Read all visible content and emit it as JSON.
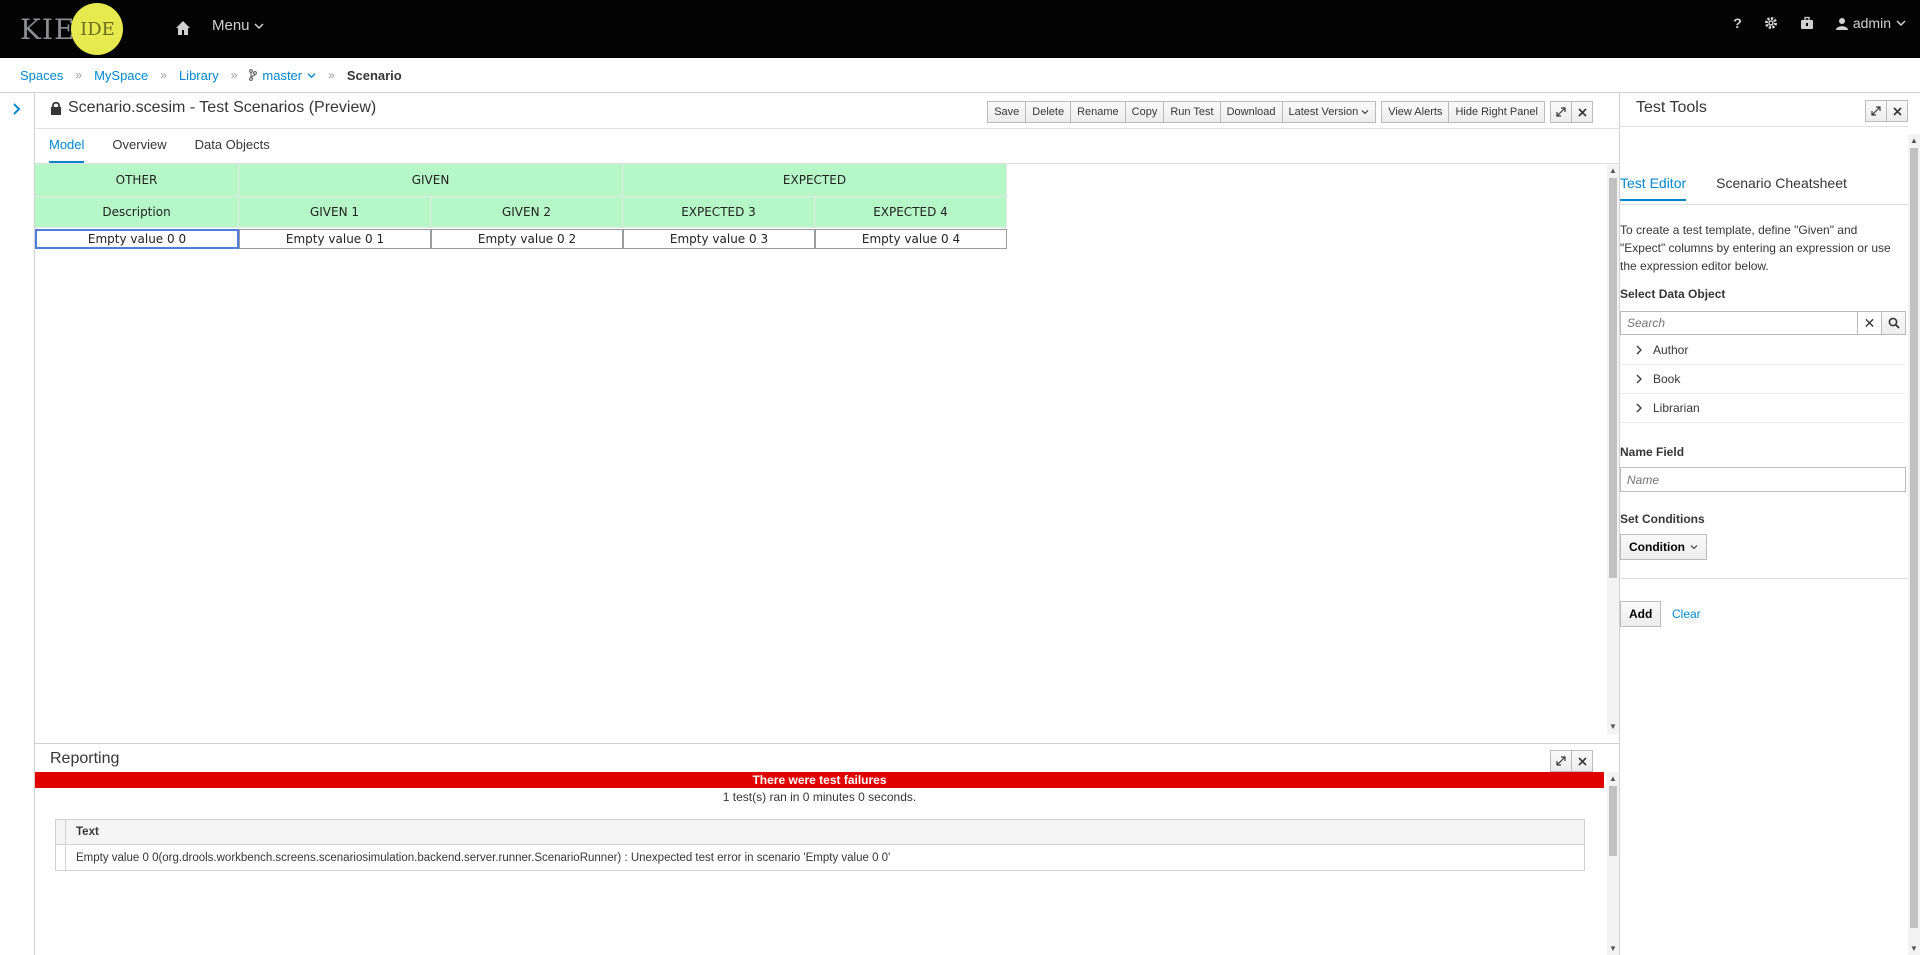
{
  "navbar": {
    "brand_kie": "KIE",
    "brand_ide": "IDE",
    "menu_label": "Menu",
    "help": "?",
    "user": "admin"
  },
  "breadcrumb": {
    "spaces": "Spaces",
    "myspace": "MySpace",
    "library": "Library",
    "branch": "master",
    "current": "Scenario"
  },
  "editor": {
    "title": "Scenario.scesim - Test Scenarios (Preview)",
    "toolbar": {
      "save": "Save",
      "delete": "Delete",
      "rename": "Rename",
      "copy": "Copy",
      "run_test": "Run Test",
      "download": "Download",
      "latest_version": "Latest Version",
      "view_alerts": "View Alerts",
      "hide_right_panel": "Hide Right Panel"
    },
    "tabs": [
      "Model",
      "Overview",
      "Data Objects"
    ]
  },
  "grid": {
    "groups": [
      "OTHER",
      "GIVEN",
      "EXPECTED"
    ],
    "columns": [
      "Description",
      "GIVEN 1",
      "GIVEN 2",
      "EXPECTED 3",
      "EXPECTED 4"
    ],
    "rows": [
      [
        "Empty value 0 0",
        "Empty value 0 1",
        "Empty value 0 2",
        "Empty value 0 3",
        "Empty value 0 4"
      ]
    ],
    "header_color": "#b6f7c8"
  },
  "reporting": {
    "title": "Reporting",
    "failure_banner": "There were test failures",
    "summary": "1 test(s) ran in 0 minutes 0 seconds.",
    "table_header": "Text",
    "messages": [
      "Empty value 0 0(org.drools.workbench.screens.scenariosimulation.backend.server.runner.ScenarioRunner) : Unexpected test error in scenario 'Empty value 0 0'"
    ],
    "failure_color": "#e00000"
  },
  "right_panel": {
    "title": "Test Tools",
    "tabs": [
      "Test Editor",
      "Scenario Cheatsheet"
    ],
    "help_text": "To create a test template, define \"Given\" and \"Expect\" columns by entering an expression or use the expression editor below.",
    "select_data_object_label": "Select Data Object",
    "search_placeholder": "Search",
    "data_objects": [
      "Author",
      "Book",
      "Librarian"
    ],
    "name_field_label": "Name Field",
    "name_placeholder": "Name",
    "set_conditions_label": "Set Conditions",
    "condition_button": "Condition",
    "add_button": "Add",
    "clear_link": "Clear"
  },
  "accent_color": "#0088ce"
}
